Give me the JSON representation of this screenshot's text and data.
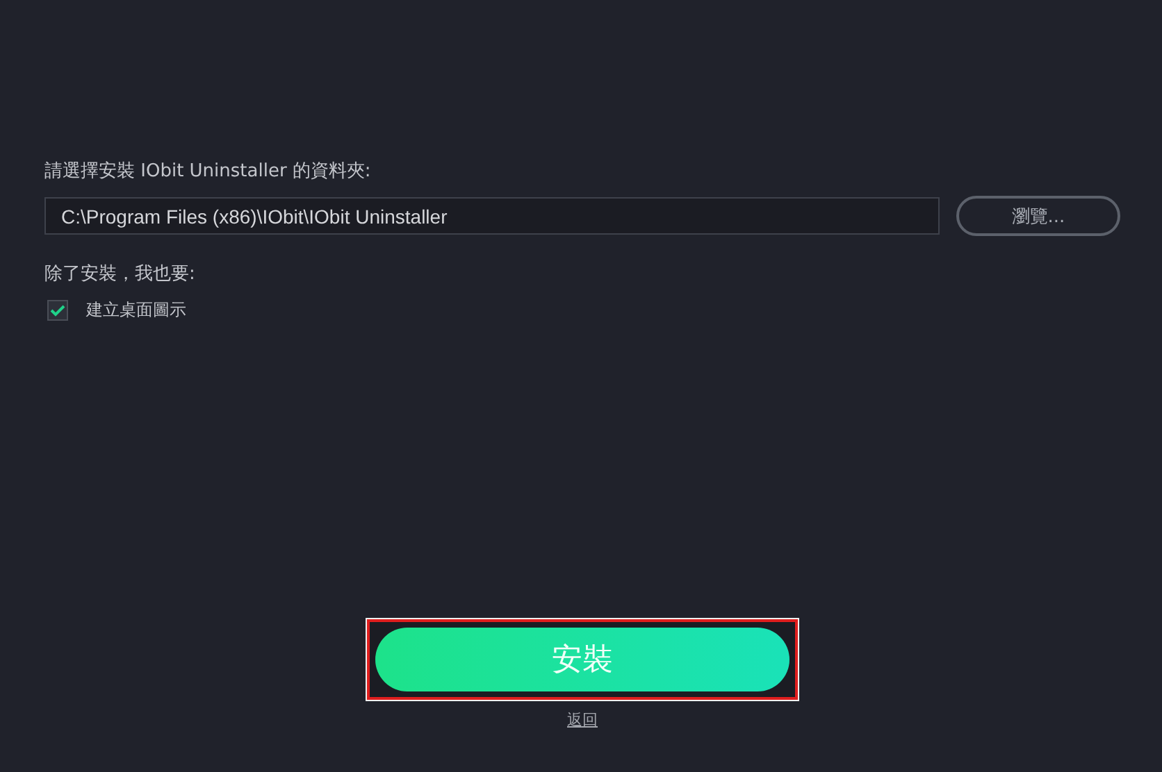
{
  "folder_label": "請選擇安裝 IObit Uninstaller 的資料夾:",
  "path_field": {
    "value": "C:\\Program Files (x86)\\IObit\\IObit Uninstaller"
  },
  "browse_button": "瀏覽...",
  "extras_label": "除了安裝，我也要:",
  "options": [
    {
      "label": "建立桌面圖示",
      "checked": true
    }
  ],
  "install_button": {
    "label": "安裝",
    "highlighted": true
  },
  "back_link": "返回"
}
